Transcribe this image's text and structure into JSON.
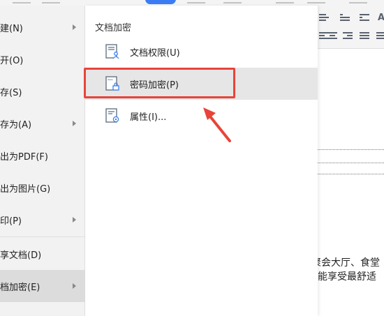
{
  "left_menu": {
    "items": [
      {
        "label": "建(N)",
        "has_arrow": true
      },
      {
        "label": "开(O)",
        "has_arrow": false
      },
      {
        "label": "存(S)",
        "has_arrow": false
      },
      {
        "label": "存为(A)",
        "has_arrow": true
      },
      {
        "label": "出为PDF(F)",
        "has_arrow": false
      },
      {
        "label": "出为图片(G)",
        "has_arrow": false
      },
      {
        "label": "印(P)",
        "has_arrow": true
      },
      {
        "label": "享文档(D)",
        "has_arrow": false
      },
      {
        "label": "档加密(E)",
        "has_arrow": true,
        "selected": true
      }
    ]
  },
  "submenu": {
    "title": "文档加密",
    "items": [
      {
        "label": "文档权限(U)",
        "icon": "document-permission-icon"
      },
      {
        "label": "密码加密(P)",
        "icon": "document-password-icon",
        "hovered": true
      },
      {
        "label": "属性(I)...",
        "icon": "document-properties-icon"
      }
    ]
  },
  "document": {
    "line1": "聚会大厅、食堂",
    "line2": "能享受最舒适"
  },
  "annotation": {
    "highlight_color": "#e8443a"
  }
}
